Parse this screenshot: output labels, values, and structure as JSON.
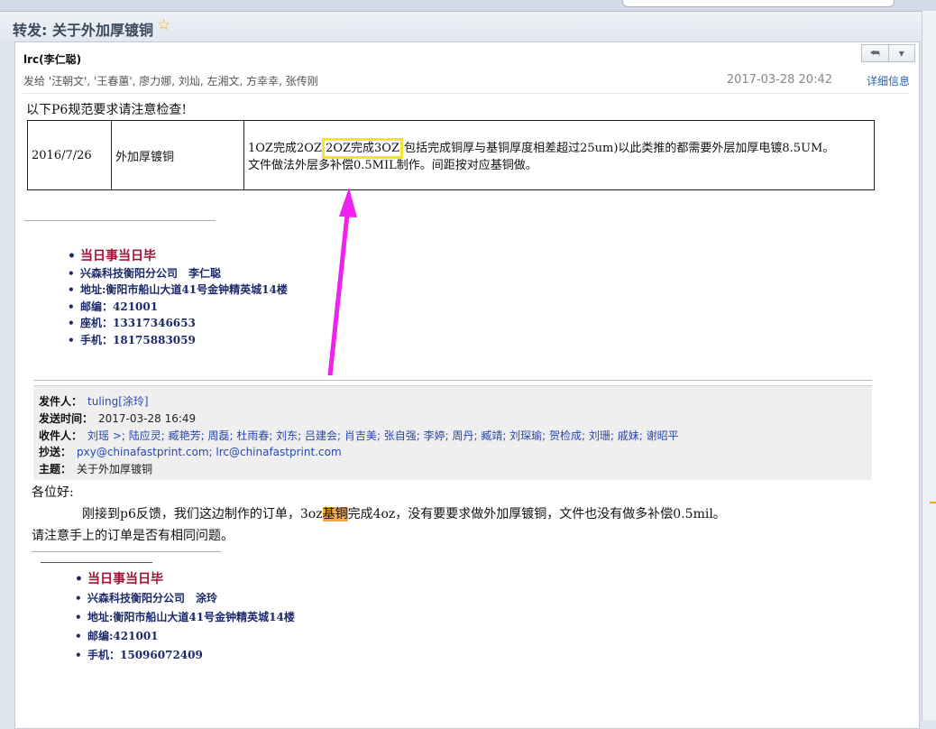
{
  "window": {
    "subject": "转发: 关于外加厚镀铜",
    "star_icon": "star-icon"
  },
  "message": {
    "sender": "lrc(李仁聪)",
    "recipients": "发给 '汪朝文', '王春蕙', 廖力娜, 刘灿, 左湘文, 方幸幸, 张传刚",
    "date": "2017-03-28 20:42",
    "details_link": "详细信息",
    "buttons": {
      "reply_icon": "reply-icon",
      "dropdown_icon": "chevron-down-icon"
    }
  },
  "body": {
    "intro": "以下P6规范要求请注意检查!",
    "table": {
      "date": "2016/7/26",
      "item": "外加厚镀铜",
      "desc_part1": "1OZ完成2OZ",
      "desc_highlight": "2OZ完成3OZ",
      "desc_part2": "(包括完成铜厚与基铜厚度相差超过25um)以此类推的都需要外层加厚电镀8.5UM。",
      "desc_line2": "文件做法外层多补偿0.5MIL制作。间距按对应基铜做。"
    },
    "signature1": {
      "motto": "当日事当日毕",
      "company": "兴森科技衡阳分公司　李仁聪",
      "address": "地址:衡阳市船山大道41号金钟精英城14楼",
      "postcode": "邮编：421001",
      "phone": "座机：13317346653",
      "mobile": "手机：18175883059"
    },
    "forward": {
      "from_label": "发件人：",
      "from": "tuling[涂玲]",
      "sent_label": "发送时间：",
      "sent": "2017-03-28 16:49",
      "to_label": "收件人：",
      "to": "刘瑶 >; 陆应灵; 臧艳芳; 周磊; 杜雨春; 刘东; 吕建会; 肖吉美; 张自强; 李婷; 周丹; 臧靖; 刘琛瑜; 贺检成; 刘珊; 戚妹; 谢昭平",
      "cc_label": "抄送：",
      "cc": "pxy@chinafastprint.com; lrc@chinafastprint.com",
      "subject_label": "主题：",
      "subject": "关于外加厚镀铜"
    },
    "greeting": "各位好:",
    "para_pre": "刚接到p6反馈，我们这边制作的订单，3oz",
    "para_highlight": "基铜",
    "para_post": "完成4oz，没有要要求做外加厚镀铜，文件也没有做多补偿0.5mil。",
    "para2": "请注意手上的订单是否有相同问题。",
    "signature2": {
      "motto": "当日事当日毕",
      "company": "兴森科技衡阳分公司　涂玲",
      "address": "地址:衡阳市船山大道41号金钟精英城14楼",
      "postcode": "邮编:421001",
      "mobile": "手机：15096072409"
    }
  },
  "colors": {
    "annotation_arrow": "#ee22ee",
    "highlight_box": "#f3e52a",
    "search_highlight": "#f7a54a"
  }
}
